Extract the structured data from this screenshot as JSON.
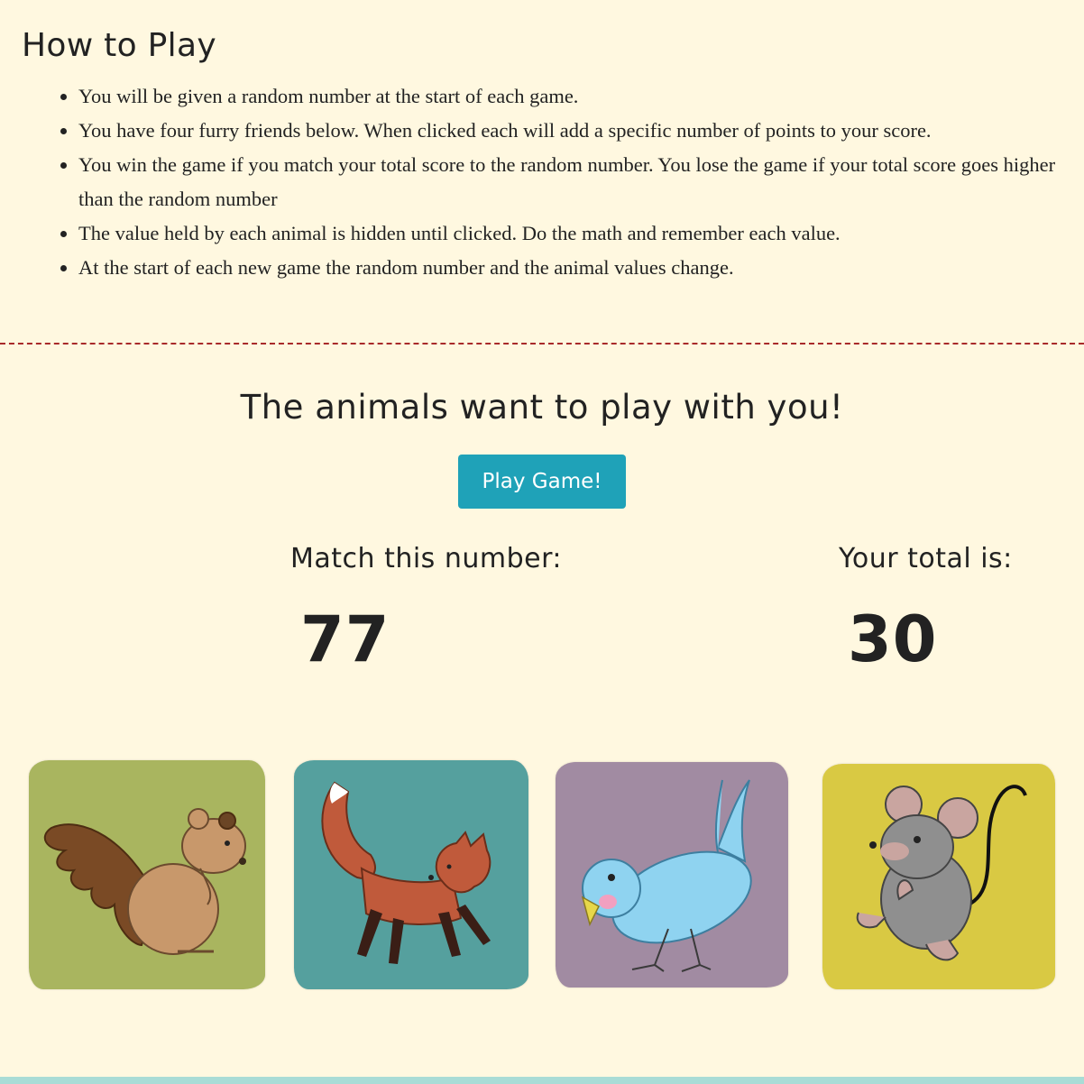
{
  "how_to_play": {
    "heading": "How to Play",
    "rules": [
      "You will be given a random number at the start of each game.",
      "You have four furry friends below. When clicked each will add a specific number of points to your score.",
      "You win the game if you match your total score to the random number. You lose the game if your total score goes higher than the random number",
      "The value held by each animal is hidden until clicked. Do the math and remember each value.",
      "At the start of each new game the random number and the animal values change."
    ]
  },
  "game": {
    "title": "The animals want to play with you!",
    "play_button": "Play Game!",
    "match_label": "Match this number:",
    "match_value": "77",
    "total_label": "Your total is:",
    "total_value": "30"
  },
  "animals": [
    {
      "name": "squirrel",
      "bg_color": "#a9b55f"
    },
    {
      "name": "fox",
      "bg_color": "#55a09e"
    },
    {
      "name": "bird",
      "bg_color": "#a18ba2"
    },
    {
      "name": "mouse",
      "bg_color": "#d9c943"
    }
  ],
  "colors": {
    "page_bg": "#fff8e0",
    "button_bg": "#1fa2b8",
    "divider": "#a82a2a"
  }
}
